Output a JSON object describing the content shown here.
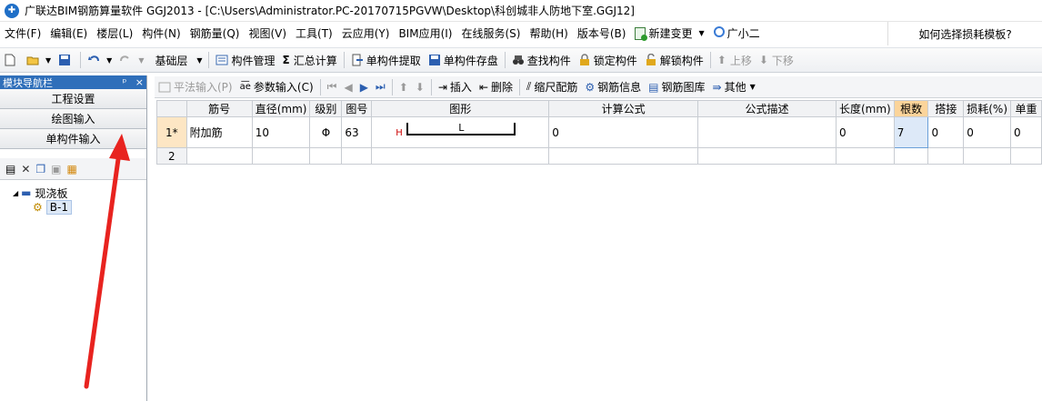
{
  "window": {
    "title": "广联达BIM钢筋算量软件 GGJ2013 - [C:\\Users\\Administrator.PC-20170715PGVW\\Desktop\\科创城非人防地下室.GGJ12]"
  },
  "menu": {
    "items": [
      "文件(F)",
      "编辑(E)",
      "楼层(L)",
      "构件(N)",
      "钢筋量(Q)",
      "视图(V)",
      "工具(T)",
      "云应用(Y)",
      "BIM应用(I)",
      "在线服务(S)",
      "帮助(H)",
      "版本号(B)"
    ],
    "new_change": "新建变更",
    "assistant": "广小二",
    "help_link": "如何选择损耗模板?"
  },
  "toolbar1": {
    "floor_combo": "基础层",
    "component_manage": "构件管理",
    "sum_calc": "汇总计算",
    "sigma": "Σ",
    "extract": "单构件提取",
    "save_disk": "单构件存盘",
    "find": "查找构件",
    "lock": "锁定构件",
    "unlock": "解锁构件",
    "move_up": "上移",
    "move_down": "下移"
  },
  "nav": {
    "header": "模块导航栏",
    "pin": "ᵖ",
    "close": "×",
    "buttons": [
      "工程设置",
      "绘图输入",
      "单构件输入"
    ],
    "tree_root": "现浇板",
    "tree_child": "B-1"
  },
  "toolbar2": {
    "flat_input": "平法输入(P)",
    "param_input": "参数输入(C)",
    "insert": "插入",
    "delete": "删除",
    "scale_rebar": "缩尺配筋",
    "rebar_info": "钢筋信息",
    "rebar_library": "钢筋图库",
    "other": "其他"
  },
  "grid": {
    "headers": [
      "",
      "筋号",
      "直径(mm)",
      "级别",
      "图号",
      "图形",
      "计算公式",
      "公式描述",
      "长度(mm)",
      "根数",
      "搭接",
      "损耗(%)",
      "单重"
    ],
    "rows": [
      {
        "num": "1*",
        "name": "附加筋",
        "diameter": "10",
        "grade": "Φ",
        "fig": "63",
        "shape_h": "H",
        "shape_l": "L",
        "formula": "0",
        "desc": "",
        "length": "0",
        "count": "7",
        "lap": "0",
        "loss": "0",
        "weight": "0"
      },
      {
        "num": "2",
        "name": "",
        "diameter": "",
        "grade": "",
        "fig": "",
        "shape_h": "",
        "shape_l": "",
        "formula": "",
        "desc": "",
        "length": "",
        "count": "",
        "lap": "",
        "loss": "",
        "weight": ""
      }
    ]
  },
  "colors": {
    "nav_header": "#2f6fba",
    "highlight_header": "#fbd49a",
    "row_head": "#fde6c4",
    "annotation_arrow": "#e8231f"
  }
}
